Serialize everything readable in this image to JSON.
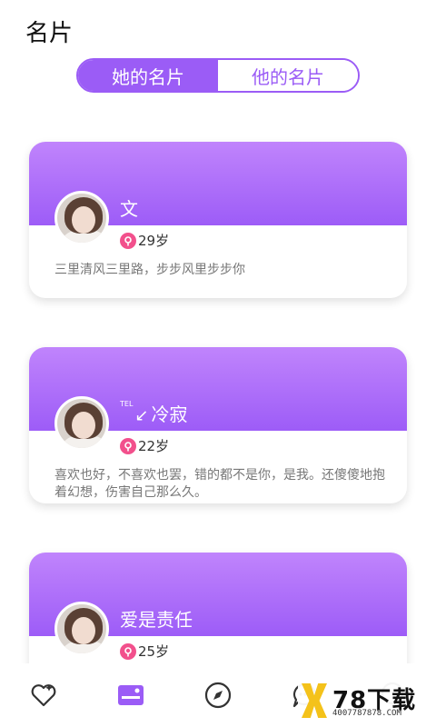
{
  "header": {
    "title": "名片"
  },
  "tabs": [
    {
      "label": "她的名片",
      "active": true
    },
    {
      "label": "他的名片",
      "active": false
    }
  ],
  "cards": [
    {
      "name": "文",
      "age": "29岁",
      "signature": "三里清风三里路，步步风里步步你"
    },
    {
      "name_prefix": "TEL",
      "name_arrow": "↙",
      "name": "冷寂",
      "age": "22岁",
      "signature": "喜欢也好，不喜欢也罢，错的都不是你，是我。还傻傻地抱着幻想，伤害自己那么久。"
    },
    {
      "name": "爱是责任",
      "age": "25岁",
      "signature": ""
    }
  ],
  "bottom_nav": [
    {
      "icon": "heart-icon"
    },
    {
      "icon": "card-icon",
      "active": true
    },
    {
      "icon": "compass-icon"
    },
    {
      "icon": "chat-icon"
    },
    {
      "icon": "profile-icon"
    }
  ],
  "watermark": {
    "text": "78下载",
    "sub": "4007787878.COM"
  },
  "colors": {
    "accent": "#9b5cf6",
    "gender_female": "#f2508c"
  }
}
